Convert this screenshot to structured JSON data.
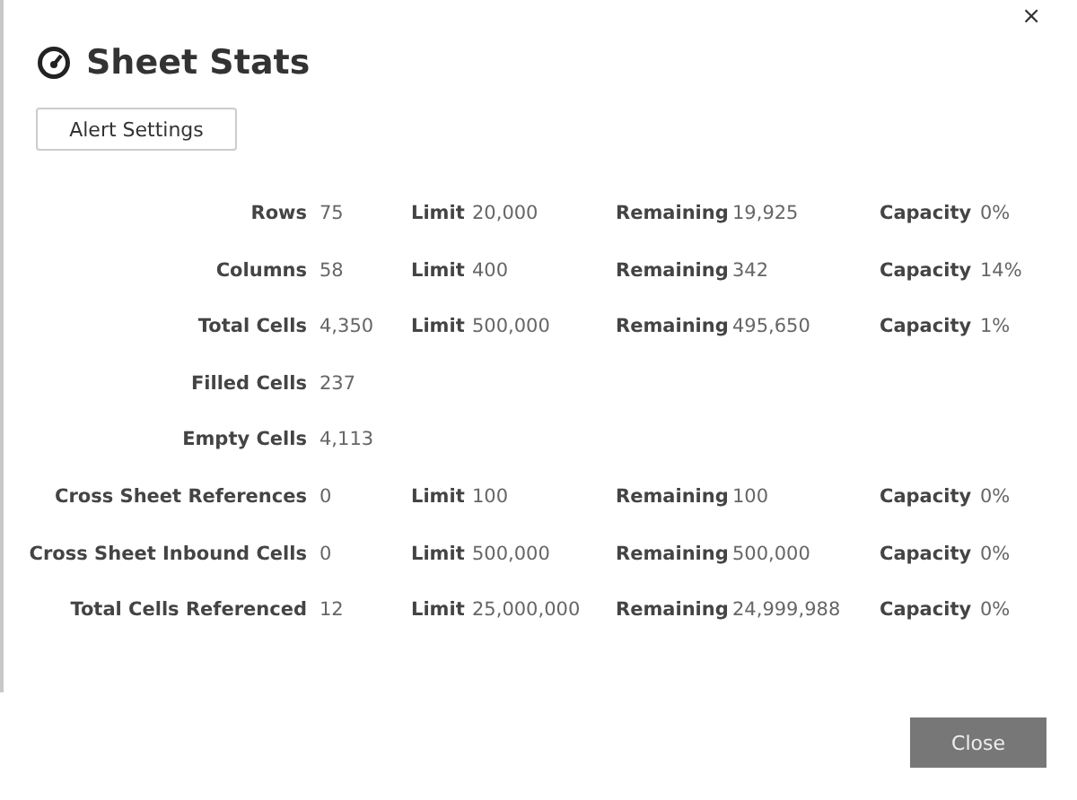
{
  "close_glyph": "×",
  "title": "Sheet Stats",
  "alert_button": "Alert Settings",
  "rows": [
    {
      "label": "Rows",
      "value": "75",
      "stats": [
        {
          "label": "Limit",
          "value": "20,000"
        },
        {
          "label": "Remaining",
          "value": "19,925"
        },
        {
          "label": "Capacity",
          "value": "0%"
        }
      ]
    },
    {
      "label": "Columns",
      "value": "58",
      "stats": [
        {
          "label": "Limit",
          "value": "400"
        },
        {
          "label": "Remaining",
          "value": "342"
        },
        {
          "label": "Capacity",
          "value": "14%"
        }
      ]
    },
    {
      "label": "Total Cells",
      "value": "4,350",
      "stats": [
        {
          "label": "Limit",
          "value": "500,000"
        },
        {
          "label": "Remaining",
          "value": "495,650"
        },
        {
          "label": "Capacity",
          "value": "1%"
        }
      ]
    },
    {
      "label": "Filled Cells",
      "value": "237"
    },
    {
      "label": "Empty Cells",
      "value": "4,113"
    },
    {
      "label": "Cross Sheet References",
      "value": "0",
      "stats": [
        {
          "label": "Limit",
          "value": "100"
        },
        {
          "label": "Remaining",
          "value": "100"
        },
        {
          "label": "Capacity",
          "value": "0%"
        }
      ]
    },
    {
      "label": "Cross Sheet Inbound Cells",
      "value": "0",
      "stats": [
        {
          "label": "Limit",
          "value": "500,000"
        },
        {
          "label": "Remaining",
          "value": "500,000"
        },
        {
          "label": "Capacity",
          "value": "0%"
        }
      ]
    },
    {
      "label": "Total Cells Referenced",
      "value": "12",
      "stats": [
        {
          "label": "Limit",
          "value": "25,000,000"
        },
        {
          "label": "Remaining",
          "value": "24,999,988"
        },
        {
          "label": "Capacity",
          "value": "0%"
        }
      ]
    }
  ],
  "close_button": "Close"
}
